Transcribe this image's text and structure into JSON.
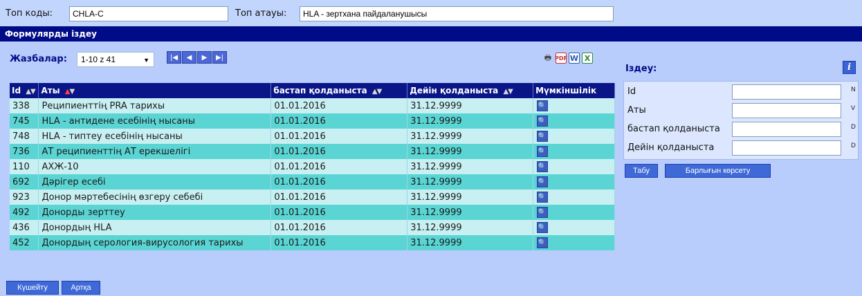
{
  "top": {
    "code_label": "Топ коды:",
    "code_value": "CHLA-C",
    "name_label": "Топ атауы:",
    "name_value": "HLA - зертхана пайдаланушысы"
  },
  "title": "Формулярды іздеу",
  "records": {
    "label": "Жазбалар:",
    "selected": "1-10 z 41"
  },
  "pager_icons": [
    "first-page-icon",
    "prev-page-icon",
    "next-page-icon",
    "last-page-icon"
  ],
  "export_icons": [
    "print-icon",
    "pdf-icon",
    "word-icon",
    "excel-icon"
  ],
  "table": {
    "headers": [
      "Id",
      "Аты",
      "бастап қолданыста",
      "Дейін қолданыста",
      "Мүмкіншілік"
    ],
    "rows": [
      {
        "id": "338",
        "name": "Реципиенттің PRA тарихы",
        "from": "01.01.2016",
        "to": "31.12.9999"
      },
      {
        "id": "745",
        "name": "HLA - антидене есебінің нысаны",
        "from": "01.01.2016",
        "to": "31.12.9999"
      },
      {
        "id": "748",
        "name": "HLA - типтеу есебінің нысаны",
        "from": "01.01.2016",
        "to": "31.12.9999"
      },
      {
        "id": "736",
        "name": "АТ реципиенттің АТ ерекшелігі",
        "from": "01.01.2016",
        "to": "31.12.9999"
      },
      {
        "id": "110",
        "name": "АХЖ-10",
        "from": "01.01.2016",
        "to": "31.12.9999"
      },
      {
        "id": "692",
        "name": "Дәрігер есебі",
        "from": "01.01.2016",
        "to": "31.12.9999"
      },
      {
        "id": "923",
        "name": "Донор мәртебесінің өзгеру себебі",
        "from": "01.01.2016",
        "to": "31.12.9999"
      },
      {
        "id": "492",
        "name": "Донорды зерттеу",
        "from": "01.01.2016",
        "to": "31.12.9999"
      },
      {
        "id": "436",
        "name": "Донордың HLA",
        "from": "01.01.2016",
        "to": "31.12.9999"
      },
      {
        "id": "452",
        "name": "Донордың серология-вирусология тарихы",
        "from": "01.01.2016",
        "to": "31.12.9999"
      }
    ]
  },
  "search": {
    "title": "Іздеу:",
    "fields": [
      {
        "label": "Id",
        "type": "N"
      },
      {
        "label": "Аты",
        "type": "V"
      },
      {
        "label": "бастап қолданыста",
        "type": "D"
      },
      {
        "label": "Дейін қолданыста",
        "type": "D"
      }
    ],
    "find_label": "Табу",
    "show_all_label": "Барлығын көрсету"
  },
  "bottom": {
    "add_label": "Күшейту",
    "back_label": "Артқа"
  }
}
